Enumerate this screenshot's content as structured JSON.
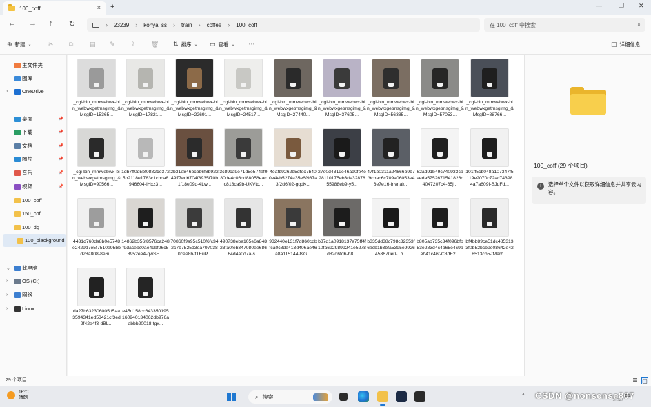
{
  "window": {
    "tab_title": "100_coff",
    "tab_close": "×",
    "tab_add": "+",
    "minimize": "—",
    "restore": "❐",
    "close": "✕"
  },
  "nav": {
    "back": "←",
    "forward": "→",
    "up": "↑",
    "refresh": "↻"
  },
  "breadcrumb": [
    "23239",
    "kohya_ss",
    "train",
    "coffee",
    "100_coff"
  ],
  "breadcrumb_sep": "›",
  "search": {
    "placeholder": "在 100_coff 中搜索",
    "icon": "search-icon"
  },
  "commands": {
    "new": "新建",
    "sort": "排序",
    "view": "查看",
    "more": "···",
    "details": "详细信息"
  },
  "sidebar": [
    {
      "label": "主文件夹",
      "icon": "home-icon",
      "color": "#f07b3f"
    },
    {
      "label": "图库",
      "icon": "gallery-icon",
      "color": "#3b8ad9"
    },
    {
      "label": "OneDrive",
      "icon": "cloud-icon",
      "color": "#1d6fd1",
      "expandable": true
    },
    {
      "label": "桌面",
      "icon": "desktop-icon",
      "color": "#2c8fd6",
      "pinned": true
    },
    {
      "label": "下载",
      "icon": "download-icon",
      "color": "#2a9d63",
      "pinned": true
    },
    {
      "label": "文档",
      "icon": "documents-icon",
      "color": "#5b7fa6",
      "pinned": true
    },
    {
      "label": "图片",
      "icon": "pictures-icon",
      "color": "#2a8bd4",
      "pinned": true
    },
    {
      "label": "音乐",
      "icon": "music-icon",
      "color": "#e0584a",
      "pinned": true
    },
    {
      "label": "视频",
      "icon": "videos-icon",
      "color": "#8a4fc2",
      "pinned": true
    },
    {
      "label": "100_coff",
      "icon": "folder-icon",
      "color": "#f2c14a"
    },
    {
      "label": "150_cof",
      "icon": "folder-icon",
      "color": "#f2c14a"
    },
    {
      "label": "100_dg",
      "icon": "folder-icon",
      "color": "#f2c14a"
    },
    {
      "label": "100_blackground",
      "icon": "folder-icon",
      "color": "#f2c14a",
      "selected": true
    },
    {
      "label": "此电脑",
      "icon": "pc-icon",
      "color": "#3d7fd0",
      "expandable": true,
      "expanded": true
    },
    {
      "label": "OS (C:)",
      "icon": "drive-icon",
      "color": "#6b7a8c",
      "expandable": true
    },
    {
      "label": "网络",
      "icon": "network-icon",
      "color": "#3d7fd0",
      "expandable": true
    },
    {
      "label": "Linux",
      "icon": "linux-icon",
      "color": "#333333",
      "expandable": true
    }
  ],
  "files": [
    {
      "name": "_cgi-bin_mmwebwx-bin_webwxgetmsgimg_&MsgID=15365...",
      "bg": "#dcdcdc",
      "fg": "#9a9a9a"
    },
    {
      "name": "_cgi-bin_mmwebwx-bin_webwxgetmsgimg_&MsgID=17821...",
      "bg": "#e8e8e6",
      "fg": "#b5b5b0"
    },
    {
      "name": "_cgi-bin_mmwebwx-bin_webwxgetmsgimg_&MsgID=22691...",
      "bg": "#2b2b2b",
      "fg": "#8c6a48"
    },
    {
      "name": "_cgi-bin_mmwebwx-bin_webwxgetmsgimg_&MsgID=24517...",
      "bg": "#eeeeec",
      "fg": "#c8c8c4"
    },
    {
      "name": "_cgi-bin_mmwebwx-bin_webwxgetmsgimg_&MsgID=27440...",
      "bg": "#6e6760",
      "fg": "#2a2a2a"
    },
    {
      "name": "_cgi-bin_mmwebwx-bin_webwxgetmsgimg_&MsgID=37605...",
      "bg": "#b9b3c6",
      "fg": "#3a3a3a"
    },
    {
      "name": "_cgi-bin_mmwebwx-bin_webwxgetmsgimg_&MsgID=56385...",
      "bg": "#7b6e62",
      "fg": "#2e2e2e"
    },
    {
      "name": "_cgi-bin_mmwebwx-bin_webwxgetmsgimg_&MsgID=57053...",
      "bg": "#8a8a88",
      "fg": "#262626"
    },
    {
      "name": "_cgi-bin_mmwebwx-bin_webwxgetmsgimg_&MsgID=88766...",
      "bg": "#4a4f58",
      "fg": "#1f1f1f"
    },
    {
      "name": "_cgi-bin_mmwebwx-bin_webwxgetmsgimg_&MsgID=90566...",
      "bg": "#d8d8d6",
      "fg": "#2a2a2a"
    },
    {
      "name": "1db7ff0d5bf08821e3725b2118e1783c1cbca8946604-IHxz3...",
      "bg": "#f2f2f2",
      "fg": "#b8b8b8"
    },
    {
      "name": "2b31e846bcbb6f8b9224977ed6704f8935f70b1f18e09d-4Lw...",
      "bg": "#6a5040",
      "fg": "#2b2b2b"
    },
    {
      "name": "3c89ca9e71d5e574af980de4c06dd88056eacc818ca9b-UKVtc...",
      "bg": "#9c9c98",
      "fg": "#3a3a3a"
    },
    {
      "name": "4eafb9262b5dfec7b400e4eb5274a35e6f987a3f2d6f02-gqdK...",
      "bg": "#e6ddd2",
      "fg": "#7a5a3e"
    },
    {
      "name": "27e0d4319e46ad0fe4e28110175eb3de3287855988eb9-y5...",
      "bg": "#3c3f46",
      "fg": "#1a1a1a"
    },
    {
      "name": "47f1b0311a24666b9b7f9cbac6c709a06053e46e7e16-fnvnak...",
      "bg": "#5b5f66",
      "fg": "#222222"
    },
    {
      "name": "62ad91b49c740933cbeeda5752671541826c4047207c4-65j...",
      "bg": "#f4f4f4",
      "fg": "#202020"
    },
    {
      "name": "101ff5cb048a107347f5119e2070c72ac743984a7a609f-BJqFd...",
      "bg": "#f1f1f1",
      "fg": "#1e1e1e"
    },
    {
      "name": "4431d760da8b0e5748e2429d7e5f7510e95bbd28a808-8e6i...",
      "bg": "#f0f0f0",
      "fg": "#9d9d9d"
    },
    {
      "name": "14862b356f8576ca248f9dacebc0ae49bf96c58952ee4-qwSH...",
      "bg": "#d9d6d2",
      "fg": "#1e1e1e"
    },
    {
      "name": "70860f9a95c510f6fc342c7b7525d3ea7970380cee8b-fTEuP...",
      "bg": "#d2d2d0",
      "fg": "#3b3b3b"
    },
    {
      "name": "490738eba105e6a84823fa0feb347080ee68664d4a0d7a-s...",
      "bg": "#e6e6e6",
      "fg": "#333333"
    },
    {
      "name": "932440e131f7d860cdbfca0c8da413d406ae46a8a115144-tsG...",
      "bg": "#8a7560",
      "fg": "#3a3a3a"
    },
    {
      "name": "b37d1a0918137a75ff4f10fa6929899241e5278d82d6fd6-h8...",
      "bg": "#6c6a68",
      "fg": "#1c1c1c"
    },
    {
      "name": "b335dd38c798c32353f6acb1b3bfa5395e9926453670e0-Tb...",
      "bg": "#f3f3f3",
      "fg": "#1a1a1a"
    },
    {
      "name": "b805ab735c34f096bfb53e283d4c4b65e4c9beb41c46f-C3dE2...",
      "bg": "#f2f2f2",
      "fg": "#1e1e1e"
    },
    {
      "name": "bf4bb89ce51dc4853133f0b52bcb9e08642e428513cb5-tMarh...",
      "bg": "#efefef",
      "fg": "#2a2a2a"
    },
    {
      "name": "da27b632306005d5aa3594341ed53421cf3ed2f42e4f3-dBL...",
      "bg": "#f2f2f2",
      "fg": "#222222"
    },
    {
      "name": "e45d158cc643350195160940134062db976aabbb20018-tgx...",
      "bg": "#f4f4f4",
      "fg": "#252525"
    }
  ],
  "details_pane": {
    "title": "100_coff (29 个项目)",
    "info": "选择单个文件以获取详细信息并共享云内容。",
    "info_icon": "i"
  },
  "status": {
    "count": "29 个项目",
    "view_details": "☰",
    "view_thumbs": "▢"
  },
  "taskbar": {
    "weather_temp": "16°C",
    "weather_desc": "晴朗",
    "search_label": "搜索",
    "tray_chevron": "^",
    "tray_lang": "中",
    "watermark": "CSDN @nonsense807",
    "date": "2024/..."
  }
}
